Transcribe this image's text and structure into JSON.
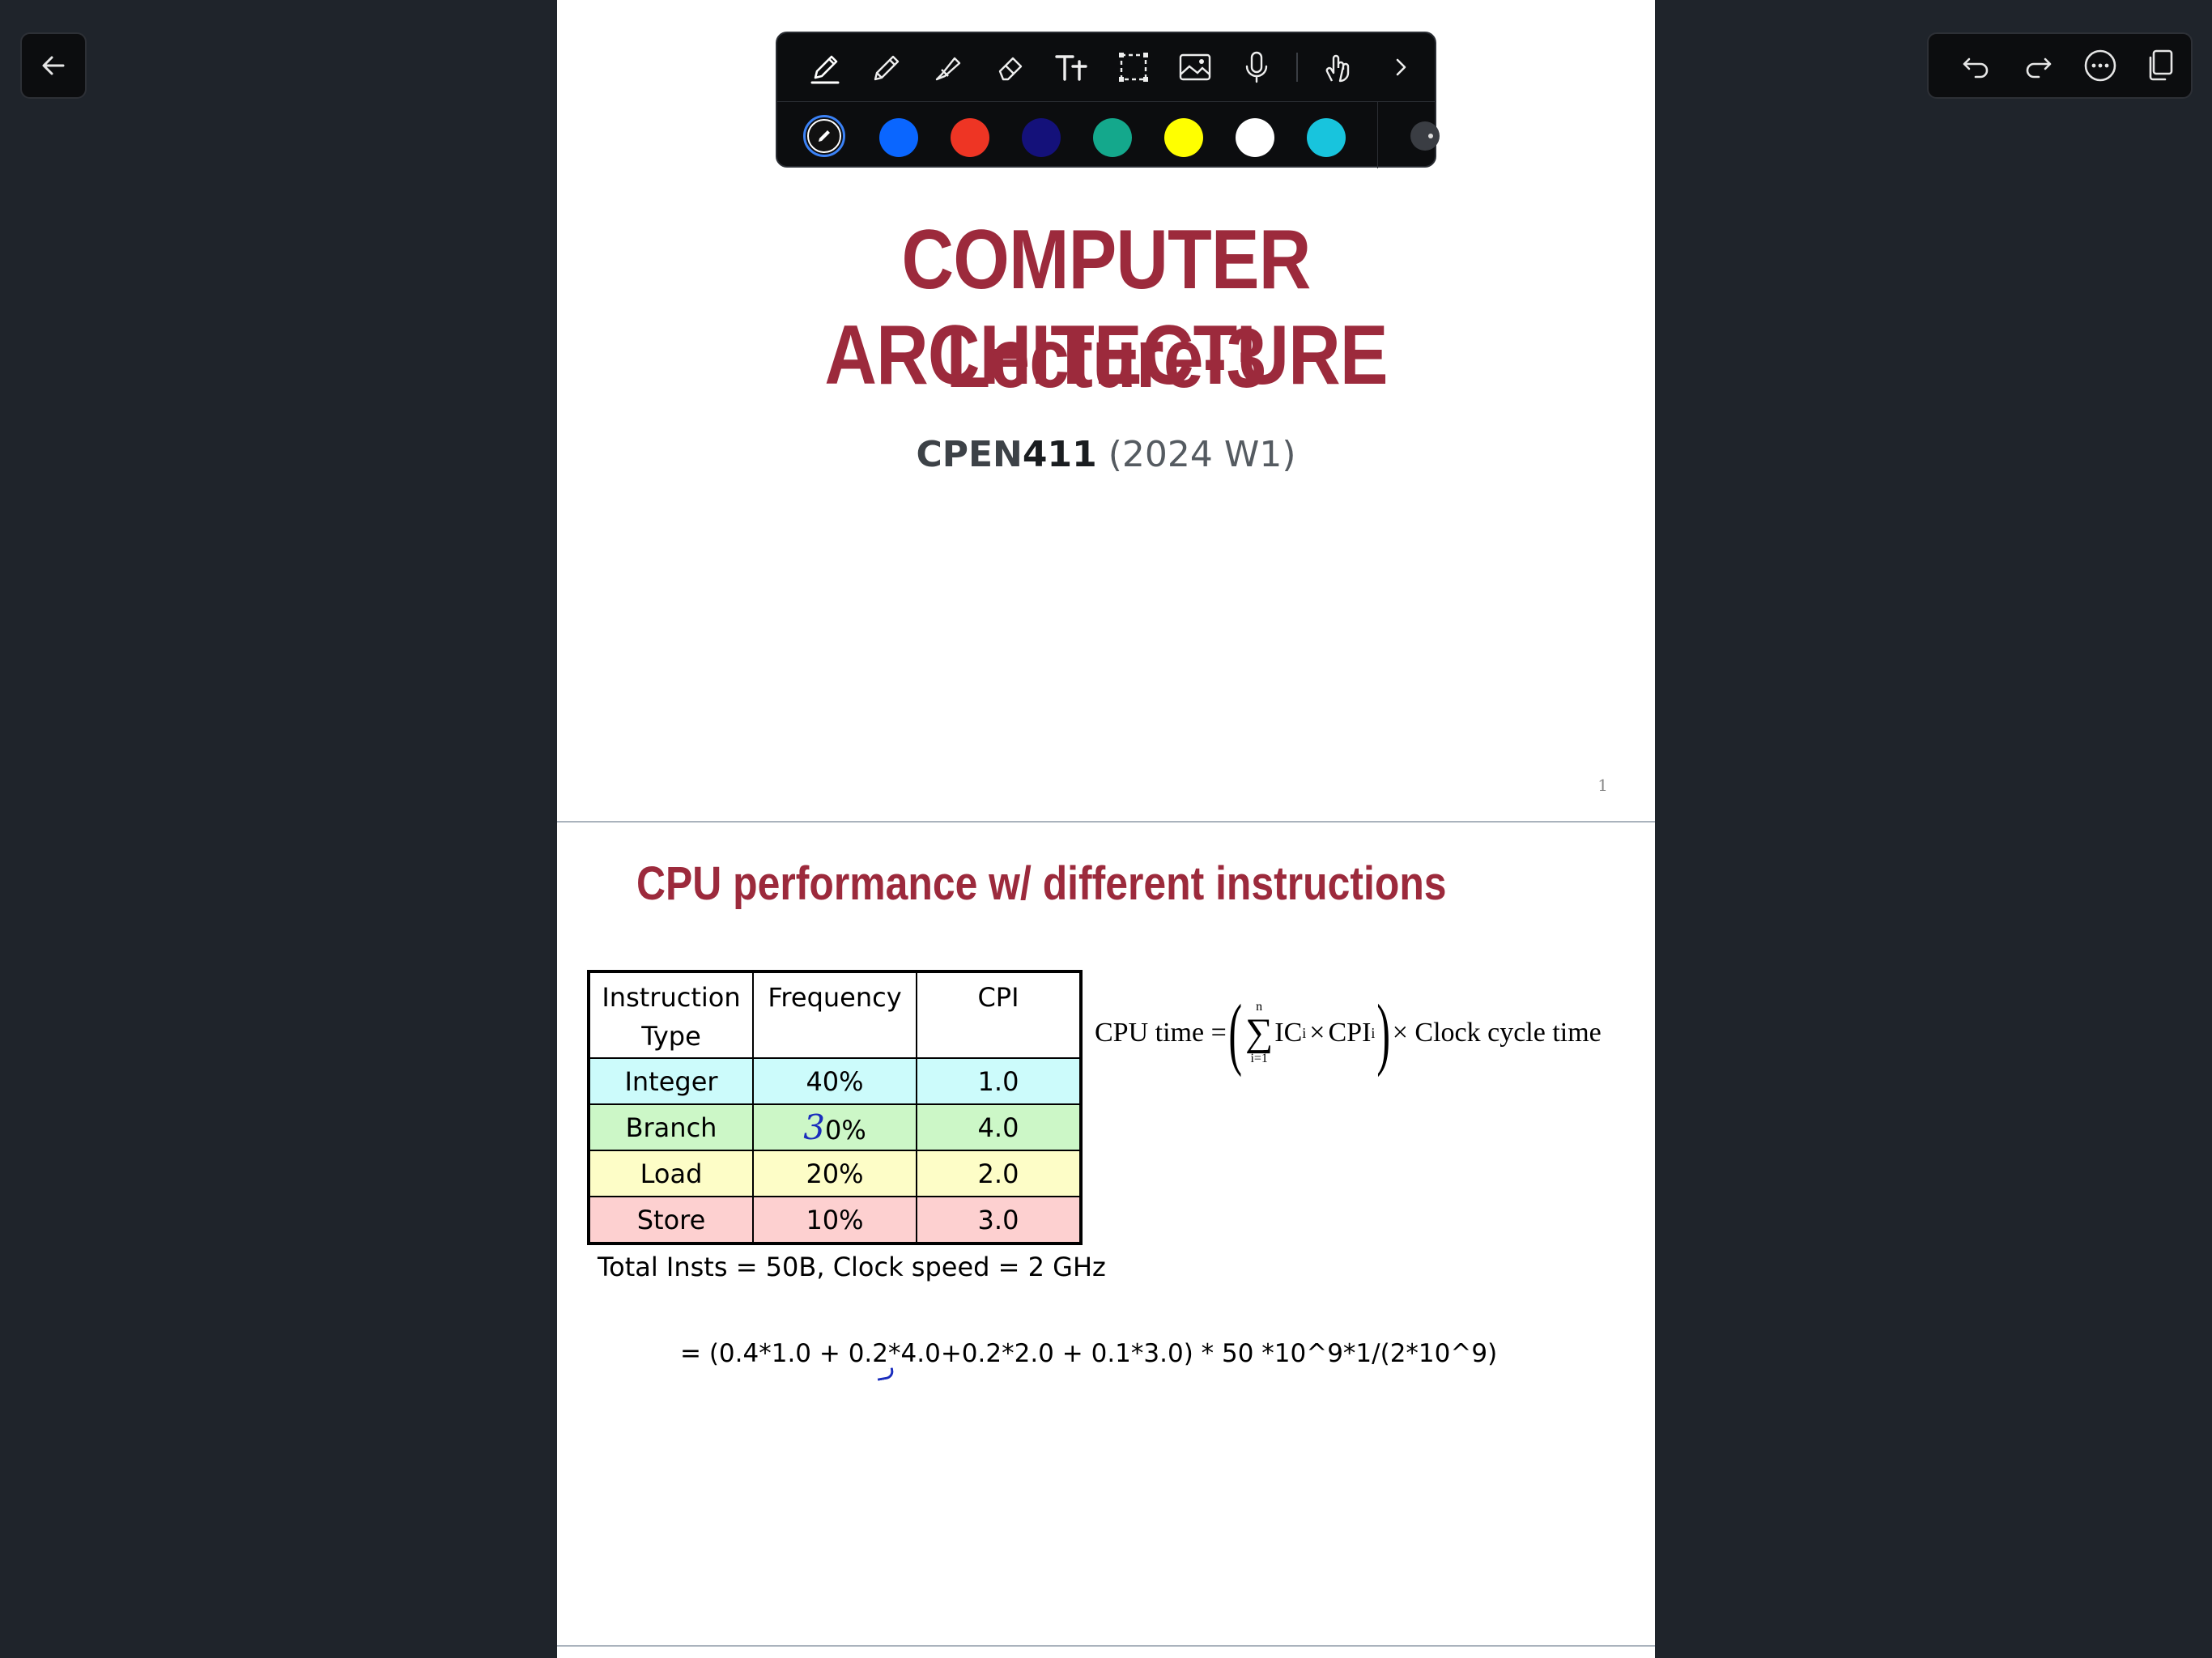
{
  "toolbar": {
    "tools": [
      "pen-tool",
      "pencil-tool",
      "highlighter-tool",
      "eraser-tool",
      "text-tool",
      "lasso-select-tool",
      "image-tool",
      "microphone-tool",
      "hand-touch-tool",
      "expand-chevron"
    ],
    "colors": [
      "#0a66ff",
      "#ee3524",
      "#14117a",
      "#14a88c",
      "#ffff00",
      "#ffffff",
      "#18c4dd"
    ],
    "selected_color": "#111111"
  },
  "slide1": {
    "title_line1": "COMPUTER ARCHITECTURE",
    "title_line2": "Lecture-3",
    "course_prefix": "CPEN",
    "course_number": "411",
    "term": "(2024 W1)",
    "page_number": "1"
  },
  "slide2": {
    "title": "CPU performance w/ different instructions",
    "table": {
      "headers": [
        "Instruction Type",
        "Frequency",
        "CPI"
      ],
      "rows": [
        [
          "Integer",
          "40%",
          "1.0"
        ],
        [
          "Branch",
          "30%",
          "4.0"
        ],
        [
          "Load",
          "20%",
          "2.0"
        ],
        [
          "Store",
          "10%",
          "3.0"
        ]
      ],
      "branch_freq_printed": "0%",
      "branch_freq_handwritten": "3"
    },
    "formula": {
      "lhs": "CPU time =",
      "sum_upper": "n",
      "sum_lower": "i=1",
      "term_ic": "IC",
      "times": "×",
      "term_cpi": "CPI",
      "sub": "i",
      "rhs": "× Clock cycle time"
    },
    "totals": "Total Insts = 50B, Clock speed = 2 GHz",
    "calc_before": "= (0.4*1.0 + 0.",
    "calc_ink": "2",
    "calc_after": "*4.0+0.2*2.0 + 0.1*3.0) * 50 *10^9*1/(2*10^9)"
  }
}
